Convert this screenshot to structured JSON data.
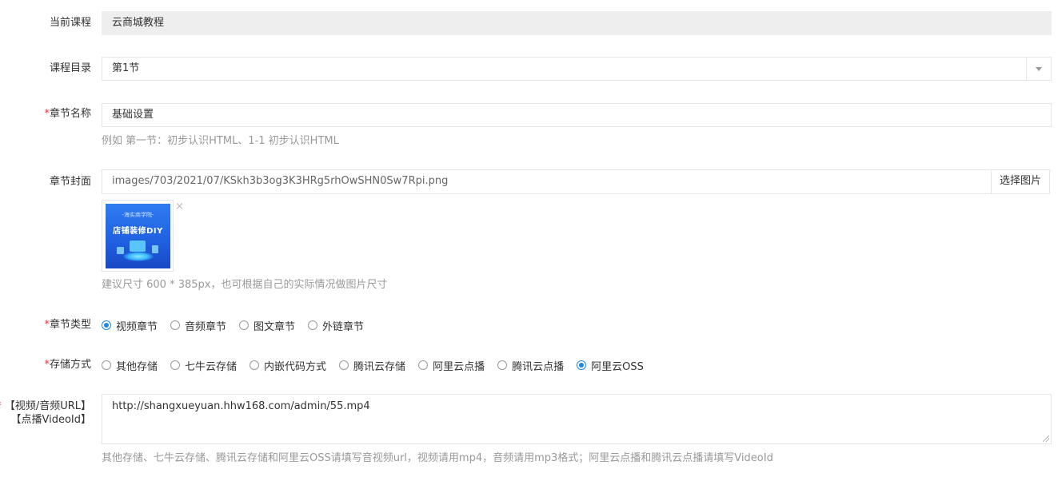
{
  "course": {
    "label": "当前课程",
    "value": "云商城教程"
  },
  "catalog": {
    "label": "课程目录",
    "value": "第1节"
  },
  "chapter_name": {
    "required_mark": "*",
    "label": "章节名称",
    "value": "基础设置",
    "hint": "例如 第一节：初步认识HTML、1-1 初步认识HTML"
  },
  "chapter_cover": {
    "label": "章节封面",
    "path": "images/703/2021/07/KSkh3b3og3K3HRg5rhOwSHN0Sw7Rpi.png",
    "choose_button": "选择图片",
    "thumb_top_text": "-海实商学院-",
    "thumb_title": "店铺装修DIY",
    "remove_glyph": "×",
    "hint": "建议尺寸 600 * 385px，也可根据自己的实际情况做图片尺寸"
  },
  "chapter_type": {
    "required_mark": "*",
    "label": "章节类型",
    "options": [
      "视频章节",
      "音频章节",
      "图文章节",
      "外链章节"
    ],
    "selected": "视频章节"
  },
  "storage": {
    "required_mark": "*",
    "label": "存储方式",
    "options": [
      "其他存储",
      "七牛云存储",
      "内嵌代码方式",
      "腾讯云存储",
      "阿里云点播",
      "腾讯云点播",
      "阿里云OSS"
    ],
    "selected": "阿里云OSS"
  },
  "media_url": {
    "required_mark": "*",
    "label_line1": "【视频/音频URL】",
    "label_line2": "【点播VideoId】",
    "value": "http://shangxueyuan.hhw168.com/admin/55.mp4",
    "hint": "其他存储、七牛云存储、腾讯云存储和阿里云OSS请填写音视频url，视频请用mp4，音频请用mp3格式；阿里云点播和腾讯云点播请填写VideoId"
  },
  "colors": {
    "accent": "#1e88e5",
    "required": "#e4393c",
    "hint": "#999999",
    "border": "#e6e6e6",
    "readonly_bg": "#eeeeee"
  }
}
